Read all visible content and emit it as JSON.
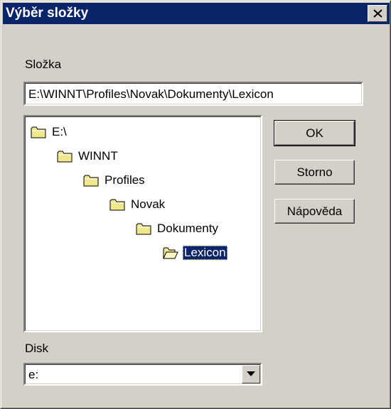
{
  "window": {
    "title": "Výběr složky"
  },
  "folder": {
    "label": "Složka",
    "path": "E:\\WINNT\\Profiles\\Novak\\Dokumenty\\Lexicon"
  },
  "tree": {
    "nodes": [
      {
        "label": "E:\\",
        "depth": 0,
        "selected": false
      },
      {
        "label": "WINNT",
        "depth": 1,
        "selected": false
      },
      {
        "label": "Profiles",
        "depth": 2,
        "selected": false
      },
      {
        "label": "Novak",
        "depth": 3,
        "selected": false
      },
      {
        "label": "Dokumenty",
        "depth": 4,
        "selected": false
      },
      {
        "label": "Lexicon",
        "depth": 5,
        "selected": true
      }
    ]
  },
  "buttons": {
    "ok": "OK",
    "cancel": "Storno",
    "help": "Nápověda"
  },
  "disk": {
    "label": "Disk",
    "value": "e:"
  }
}
